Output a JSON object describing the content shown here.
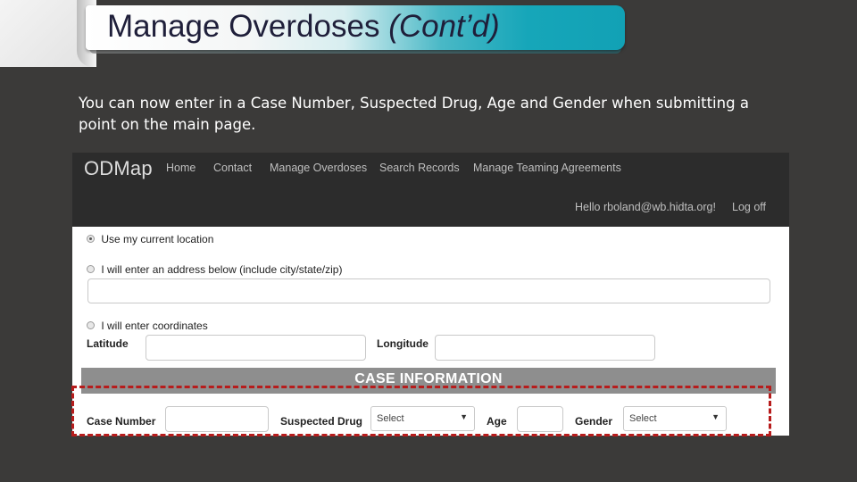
{
  "slide": {
    "title_main": "Manage Overdoses",
    "title_cont": "(Cont’d)",
    "body": "You can now enter in a Case Number, Suspected Drug, Age and Gender when submitting a point on the main page."
  },
  "app": {
    "brand": "ODMap",
    "nav": [
      "Home",
      "Contact",
      "Manage Overdoses",
      "Search Records",
      "Manage Teaming Agreements"
    ],
    "user_greeting": "Hello rboland@wb.hidta.org!",
    "logoff": "Log off"
  },
  "location": {
    "options": [
      {
        "label": "Use my current location",
        "checked": true
      },
      {
        "label": "I will enter an address below (include city/state/zip)",
        "checked": false
      },
      {
        "label": "I will enter coordinates",
        "checked": false
      }
    ],
    "address_value": "",
    "latitude_label": "Latitude",
    "latitude_value": "",
    "longitude_label": "Longitude",
    "longitude_value": ""
  },
  "case": {
    "header": "CASE INFORMATION",
    "case_number_label": "Case Number",
    "case_number_value": "",
    "drug_label": "Suspected Drug",
    "drug_selected": "Select",
    "age_label": "Age",
    "age_value": "",
    "gender_label": "Gender",
    "gender_selected": "Select"
  },
  "colors": {
    "slide_bg": "#3b3a39",
    "title_accent": "#16a6b9",
    "highlight": "#b71c1c",
    "nav_bg": "#2c2c2c"
  }
}
